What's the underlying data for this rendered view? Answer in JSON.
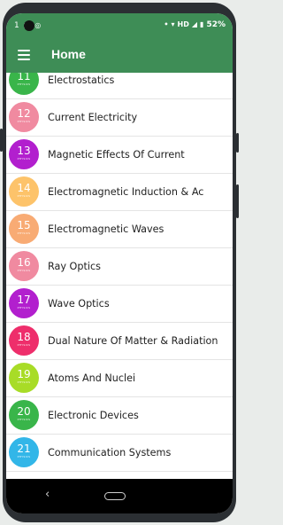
{
  "status_bar": {
    "time": "1",
    "battery": "52%",
    "network": "HD"
  },
  "appbar": {
    "title": "Home"
  },
  "chapters": [
    {
      "number": "11",
      "sub": "PHYSICS",
      "label": "Electrostatics",
      "color": "#39b54a"
    },
    {
      "number": "12",
      "sub": "PHYSICS",
      "label": "Current Electricity",
      "color": "#f08aa0"
    },
    {
      "number": "13",
      "sub": "PHYSICS",
      "label": "Magnetic Effects Of Current",
      "color": "#b21fce"
    },
    {
      "number": "14",
      "sub": "PHYSICS",
      "label": "Electromagnetic Induction & Ac",
      "color": "#fdc36a"
    },
    {
      "number": "15",
      "sub": "PHYSICS",
      "label": "Electromagnetic Waves",
      "color": "#f8ab74"
    },
    {
      "number": "16",
      "sub": "PHYSICS",
      "label": "Ray Optics",
      "color": "#f08aa0"
    },
    {
      "number": "17",
      "sub": "PHYSICS",
      "label": "Wave Optics",
      "color": "#b21fce"
    },
    {
      "number": "18",
      "sub": "PHYSICS",
      "label": "Dual Nature Of Matter & Radiation",
      "color": "#ee2e6b"
    },
    {
      "number": "19",
      "sub": "PHYSICS",
      "label": "Atoms And Nuclei",
      "color": "#a8dc27"
    },
    {
      "number": "20",
      "sub": "PHYSICS",
      "label": "Electronic Devices",
      "color": "#39b54a"
    },
    {
      "number": "21",
      "sub": "PHYSICS",
      "label": "Communication Systems",
      "color": "#32b6e8"
    }
  ],
  "icons": [
    "menu-icon",
    "back-icon",
    "home-icon"
  ]
}
